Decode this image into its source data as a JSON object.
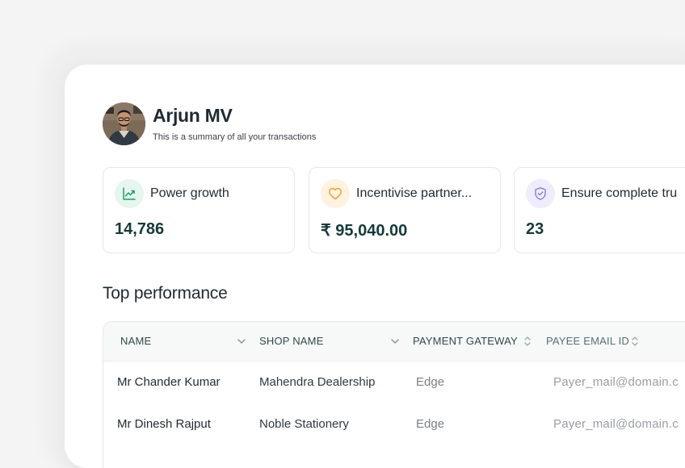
{
  "profile": {
    "name": "Arjun MV",
    "subtitle": "This is a summary of all your transactions"
  },
  "stats": [
    {
      "label": "Power growth",
      "value": "14,786",
      "icon": "trend-up-icon",
      "icon_color": "#1f9d6b",
      "icon_bg": "#e6f6ee"
    },
    {
      "label": "Incentivise partner...",
      "value": "₹ 95,040.00",
      "icon": "heart-icon",
      "icon_color": "#f0a43a",
      "icon_bg": "#fff2e0"
    },
    {
      "label": "Ensure complete tru",
      "value": "23",
      "icon": "shield-icon",
      "icon_color": "#8a7ad6",
      "icon_bg": "#efecfb"
    }
  ],
  "section": {
    "title": "Top performance"
  },
  "table": {
    "headers": [
      "NAME",
      "SHOP NAME",
      "PAYMENT GATEWAY",
      "PAYEE EMAIL ID"
    ],
    "rows": [
      {
        "name": "Mr Chander Kumar",
        "shop": "Mahendra Dealership",
        "gateway": "Edge",
        "email": "Payer_mail@domain.c"
      },
      {
        "name": "Mr Dinesh Rajput",
        "shop": "Noble Stationery",
        "gateway": "Edge",
        "email": "Payer_mail@domain.c"
      }
    ]
  }
}
